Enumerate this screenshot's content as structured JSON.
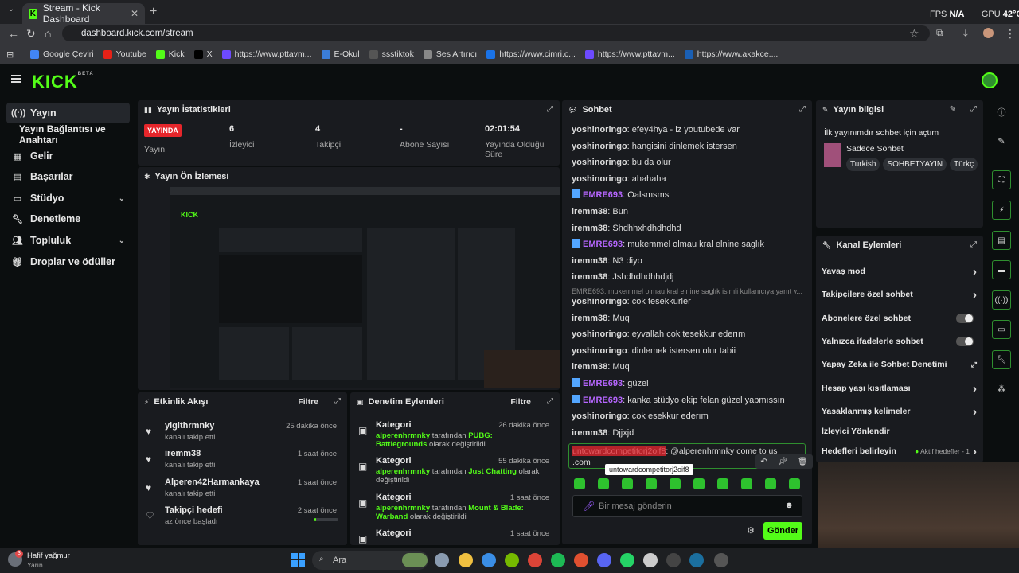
{
  "browser": {
    "tab_title": "Stream - Kick Dashboard",
    "url": "dashboard.kick.com/stream",
    "fps_label": "FPS",
    "fps_value": "N/A",
    "gpu_label": "GPU",
    "gpu_value": "42°C",
    "bookmarks": [
      "Google Çeviri",
      "Youtube",
      "Kick",
      "X",
      "https://www.pttavm...",
      "E-Okul",
      "ssstiktok",
      "Ses Artırıcı",
      "https://www.cimri.c...",
      "https://www.pttavm...",
      "https://www.akakce...."
    ]
  },
  "header": {
    "logo": "KICK",
    "logo_badge": "BETA"
  },
  "sidebar": {
    "items": [
      {
        "label": "Yayın",
        "icon": "broadcast-icon"
      },
      {
        "label": "Yayın Bağlantısı ve Anahtarı",
        "icon": ""
      },
      {
        "label": "Gelir",
        "icon": "chart-icon"
      },
      {
        "label": "Başarılar",
        "icon": "grid-icon"
      },
      {
        "label": "Stüdyo",
        "icon": "studio-icon"
      },
      {
        "label": "Denetleme",
        "icon": "wrench-icon"
      },
      {
        "label": "Topluluk",
        "icon": "people-icon"
      },
      {
        "label": "Droplar ve ödüller",
        "icon": "gift-icon"
      }
    ]
  },
  "stats": {
    "title": "Yayın İstatistikleri",
    "items": [
      {
        "value": "YAYINDA",
        "label": "Yayın"
      },
      {
        "value": "6",
        "label": "İzleyici"
      },
      {
        "value": "4",
        "label": "Takipçi"
      },
      {
        "value": "-",
        "label": "Abone Sayısı"
      },
      {
        "value": "02:01:54",
        "label": "Yayında Olduğu Süre"
      }
    ]
  },
  "preview": {
    "title": "Yayın Ön İzlemesi"
  },
  "activity": {
    "title": "Etkinlik Akışı",
    "filter": "Filtre",
    "items": [
      {
        "name": "yigithrmnky",
        "sub": "kanalı takip etti",
        "time": "25 dakika önce"
      },
      {
        "name": "iremm38",
        "sub": "kanalı takip etti",
        "time": "1 saat önce"
      },
      {
        "name": "Alperen42Harmankaya",
        "sub": "kanalı takip etti",
        "time": "1 saat önce"
      },
      {
        "name": "Takipçi hedefi",
        "sub": "az önce başladı",
        "time": "2 saat önce"
      }
    ],
    "goal_progress": 0.05
  },
  "moderation": {
    "title": "Denetim Eylemleri",
    "filter": "Filtre",
    "items": [
      {
        "name": "Kategori",
        "user": "alperenhrmnky",
        "mid": " tarafından ",
        "cat": "PUBG: Battlegrounds",
        "end": " olarak değiştirildi",
        "time": "26 dakika önce"
      },
      {
        "name": "Kategori",
        "user": "alperenhrmnky",
        "mid": " tarafından ",
        "cat": "Just Chatting",
        "end": " olarak değiştirildi",
        "time": "55 dakika önce"
      },
      {
        "name": "Kategori",
        "user": "alperenhrmnky",
        "mid": " tarafından ",
        "cat": "Mount & Blade: Warband",
        "end": " olarak değiştirildi",
        "time": "1 saat önce"
      },
      {
        "name": "Kategori",
        "user": "",
        "mid": "",
        "cat": "",
        "end": "",
        "time": "1 saat önce"
      }
    ]
  },
  "chat": {
    "title": "Sohbet",
    "messages": [
      {
        "user": "yoshinoringo",
        "text": "efey4hya - iz youtubede var",
        "style": "g"
      },
      {
        "user": "yoshinoringo",
        "text": "hangisini dinlemek istersen",
        "style": "g"
      },
      {
        "user": "yoshinoringo",
        "text": "bu da olur",
        "style": "g"
      },
      {
        "user": "yoshinoringo",
        "text": "ahahaha",
        "style": "g"
      },
      {
        "user": "EMRE693",
        "text": "Oalsmsms",
        "style": "p"
      },
      {
        "user": "iremm38",
        "text": "Bun",
        "style": "g"
      },
      {
        "user": "iremm38",
        "text": "Shdhhxhdhdhdhd",
        "style": "g"
      },
      {
        "user": "EMRE693",
        "text": "mukemmel olmau kral elnine saglık",
        "style": "p"
      },
      {
        "user": "iremm38",
        "text": "N3 diyo",
        "style": "g"
      },
      {
        "user": "iremm38",
        "text": "Jshdhdhdhhdjdj",
        "style": "g"
      },
      {
        "user": "yoshinoringo",
        "text": "cok tesekkurler",
        "style": "g"
      },
      {
        "user": "iremm38",
        "text": "Muq",
        "style": "g"
      },
      {
        "user": "yoshinoringo",
        "text": "eyvallah cok tesekkur ederım",
        "style": "g"
      },
      {
        "user": "yoshinoringo",
        "text": "dinlemek istersen olur tabii",
        "style": "g"
      },
      {
        "user": "iremm38",
        "text": "Muq",
        "style": "g"
      },
      {
        "user": "EMRE693",
        "text": "güzel",
        "style": "p"
      },
      {
        "user": "EMRE693",
        "text": "kanka stüdyo ekip felan güzel yapmıssın",
        "style": "p"
      },
      {
        "user": "yoshinoringo",
        "text": "cok esekkur ederım",
        "style": "g"
      },
      {
        "user": "iremm38",
        "text": "Djjxjd",
        "style": "g"
      }
    ],
    "reply_preview": "EMRE693: mukemmel olmau kral elnine saglık isimli kullanıcıya yanıt v...",
    "pinned_user": "untowardcompetitorj2oif8",
    "pinned_text": ": @alperenhrmnky come to us",
    "pinned_line2": ".com",
    "tooltip": "untowardcompetitorj2oif8",
    "input_placeholder": "Bir mesaj gönderin",
    "send_label": "Gönder"
  },
  "stream_info": {
    "title": "Yayın bilgisi",
    "stream_title": "İlk yayınımdır sohbet için açtım",
    "category": "Sadece Sohbet",
    "tags": [
      "Turkish",
      "SOHBETYAYIN",
      "Türkç"
    ]
  },
  "channel_actions": {
    "title": "Kanal Eylemleri",
    "items": [
      {
        "label": "Yavaş mod",
        "kind": "chevron"
      },
      {
        "label": "Takipçilere özel sohbet",
        "kind": "chevron"
      },
      {
        "label": "Abonelere özel sohbet",
        "kind": "toggle"
      },
      {
        "label": "Yalnızca ifadelerle sohbet",
        "kind": "toggle"
      },
      {
        "label": "Yapay Zeka ile Sohbet Denetimi",
        "kind": "external"
      },
      {
        "label": "Hesap yaşı kısıtlaması",
        "kind": "chevron"
      },
      {
        "label": "Yasaklanmış kelimeler",
        "kind": "chevron"
      },
      {
        "label": "İzleyici Yönlendir",
        "kind": "none"
      },
      {
        "label": "Hedefleri belirleyin",
        "kind": "goal"
      }
    ],
    "goal_status": "Aktif hedefler - 1"
  },
  "taskbar": {
    "weather": "Hafif yağmur",
    "weather_sub": "Yarın",
    "weather_badge": "3",
    "search_label": "Ara"
  }
}
